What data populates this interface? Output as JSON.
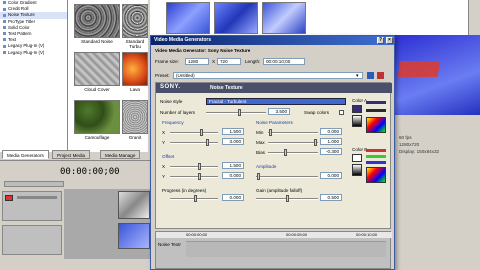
{
  "generators": [
    "Color Gradient",
    "Credit Roll",
    "Noise Texture",
    "ProType Titler",
    "Solid Color",
    "Test Pattern",
    "Text",
    "Legacy Plug-In (V)",
    "Legacy Plug-In (V)"
  ],
  "thumbnails": [
    {
      "label": "Standard Noise"
    },
    {
      "label": "Standard Turbu"
    },
    {
      "label": "Cloud Cover"
    },
    {
      "label": "Lava"
    },
    {
      "label": "Camouflage"
    },
    {
      "label": "Granit"
    }
  ],
  "tabs": [
    "Media Generators",
    "Project Media",
    "Media Manage"
  ],
  "timecode": "00:00:00;00",
  "timecode2": "00:00:00;00",
  "right_panel": {
    "line1": "60 fps",
    "line2": "1280x720",
    "line3": "Display: 150x84x32"
  },
  "dialog": {
    "title": "Video Media Generators",
    "subtitle": "Video Media Generator: Sony Noise Texture",
    "frame_size_label": "Frame size:",
    "frame_w": "1280",
    "x_label": "X",
    "frame_h": "720",
    "length_label": "Length:",
    "length_value": "00:00:10;00",
    "preset_label": "Preset:",
    "preset_value": "(Untitled)",
    "brand": "SONY.",
    "plugin_name": "Noise Texture",
    "noise_style_label": "Noise style",
    "noise_style_value": "Fractal - Turbulent",
    "layers_label": "Number of layers",
    "layers_value": "3.500",
    "swap_label": "Swap colors",
    "color_a_label": "Color A",
    "color_b_label": "Color B",
    "frequency_label": "Frequency",
    "freq_x_label": "X",
    "freq_x_value": "1.500",
    "freq_y_label": "Y",
    "freq_y_value": "3.000",
    "offset_label": "Offset",
    "off_x_label": "X",
    "off_x_value": "1.500",
    "off_y_label": "Y",
    "off_y_value": "0.000",
    "progress_label": "Progress (in degrees)",
    "progress_value": "0.000",
    "noise_params_label": "Noise Parameters",
    "min_label": "Min",
    "min_value": "0.000",
    "max_label": "Max",
    "max_value": "1.000",
    "bias_label": "Bias",
    "bias_value": "-0.300",
    "amplitude_label": "Amplitude",
    "amplitude_value": "0.000",
    "gain_label": "Gain (amplitude falloff)",
    "gain_value": "0.500",
    "timeline_label": "Noise Textr",
    "timeline_marks": [
      "00:00:00;00",
      "00:00:05;00",
      "00:00:10;00"
    ]
  },
  "colors": {
    "accent": "#0a246a",
    "red_thumb": "#d94a1a",
    "blue_media": "#3a56d8"
  }
}
